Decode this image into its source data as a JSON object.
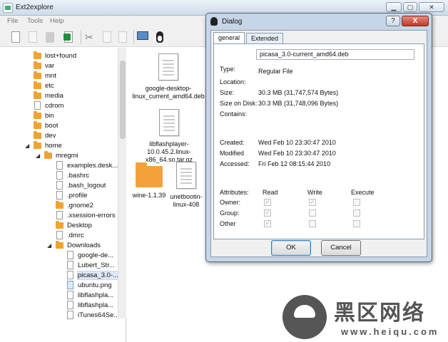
{
  "window": {
    "title": "Ext2explore"
  },
  "menu": [
    "File",
    "Tools",
    "Help"
  ],
  "tree": [
    {
      "label": "lost+found",
      "icon": "folder-icon"
    },
    {
      "label": "var",
      "icon": "folder-icon"
    },
    {
      "label": "mnt",
      "icon": "folder-icon"
    },
    {
      "label": "etc",
      "icon": "folder-icon"
    },
    {
      "label": "media",
      "icon": "folder-icon"
    },
    {
      "label": "cdrom",
      "icon": "file-icon"
    },
    {
      "label": "bin",
      "icon": "folder-icon"
    },
    {
      "label": "boot",
      "icon": "folder-icon"
    },
    {
      "label": "dev",
      "icon": "folder-icon"
    },
    {
      "label": "home",
      "icon": "folder-icon"
    },
    {
      "label": "mregmi",
      "icon": "folder-icon"
    },
    {
      "label": "examples.desk...",
      "icon": "file-icon"
    },
    {
      "label": ".bashrc",
      "icon": "file-icon"
    },
    {
      "label": ".bash_logout",
      "icon": "file-icon"
    },
    {
      "label": ".profile",
      "icon": "file-icon"
    },
    {
      "label": ".gnome2",
      "icon": "folder-icon"
    },
    {
      "label": ".xsession-errors",
      "icon": "file-icon"
    },
    {
      "label": "Desktop",
      "icon": "folder-icon"
    },
    {
      "label": ".dmrc",
      "icon": "file-icon"
    },
    {
      "label": "Downloads",
      "icon": "folder-icon"
    },
    {
      "label": "google-de...",
      "icon": "file-icon"
    },
    {
      "label": "Lubert_Str...",
      "icon": "file-icon"
    },
    {
      "label": "picasa_3.0-...",
      "icon": "file-icon"
    },
    {
      "label": "ubuntu.png",
      "icon": "image-file-icon"
    },
    {
      "label": "libflashpla...",
      "icon": "file-icon"
    },
    {
      "label": "libflashpla...",
      "icon": "file-icon"
    },
    {
      "label": "iTunes64Se...",
      "icon": "file-icon"
    }
  ],
  "files": {
    "google": "google-desktop-linux_current_amd64.deb",
    "flash": "libflashplayer-10.0.45.2.linux-x86_64.so.tar.gz",
    "wine": "wine-1.1.39",
    "unetbootin": "unetbootin-linux-408"
  },
  "dialog": {
    "title": "Dialog",
    "help": "?",
    "close": "X",
    "tabs": [
      "general",
      "Extended"
    ],
    "filename": "picasa_3.0-current_amd64.deb",
    "labels": {
      "type": "Type:",
      "location": "Location:",
      "size": "Size:",
      "size_on_disk": "Size on Disk:",
      "contains": "Contains:",
      "created": "Created:",
      "modified": "Modified",
      "accessed": "Accessed:",
      "attributes": "Attributes:",
      "read": "Read",
      "write": "Write",
      "execute": "Execute",
      "owner": "Owner:",
      "group": "Group:",
      "other": "Other"
    },
    "values": {
      "type": "Regular File",
      "size": "30.3 MB (31,747,574 Bytes)",
      "size_on_disk": "30.3 MB (31,748,096 Bytes)",
      "created": "Wed Feb 10 23:30:47 2010",
      "modified": "Wed Feb 10 23:30:47 2010",
      "accessed": "Fri Feb 12 08:15:44 2010"
    },
    "permissions": {
      "owner": {
        "read": true,
        "write": true,
        "execute": false
      },
      "group": {
        "read": true,
        "write": false,
        "execute": false
      },
      "other": {
        "read": true,
        "write": false,
        "execute": false
      }
    },
    "ok": "OK",
    "cancel": "Cancel"
  },
  "watermark": {
    "brand": "黑区网络",
    "url": "www.heiqu.com"
  }
}
